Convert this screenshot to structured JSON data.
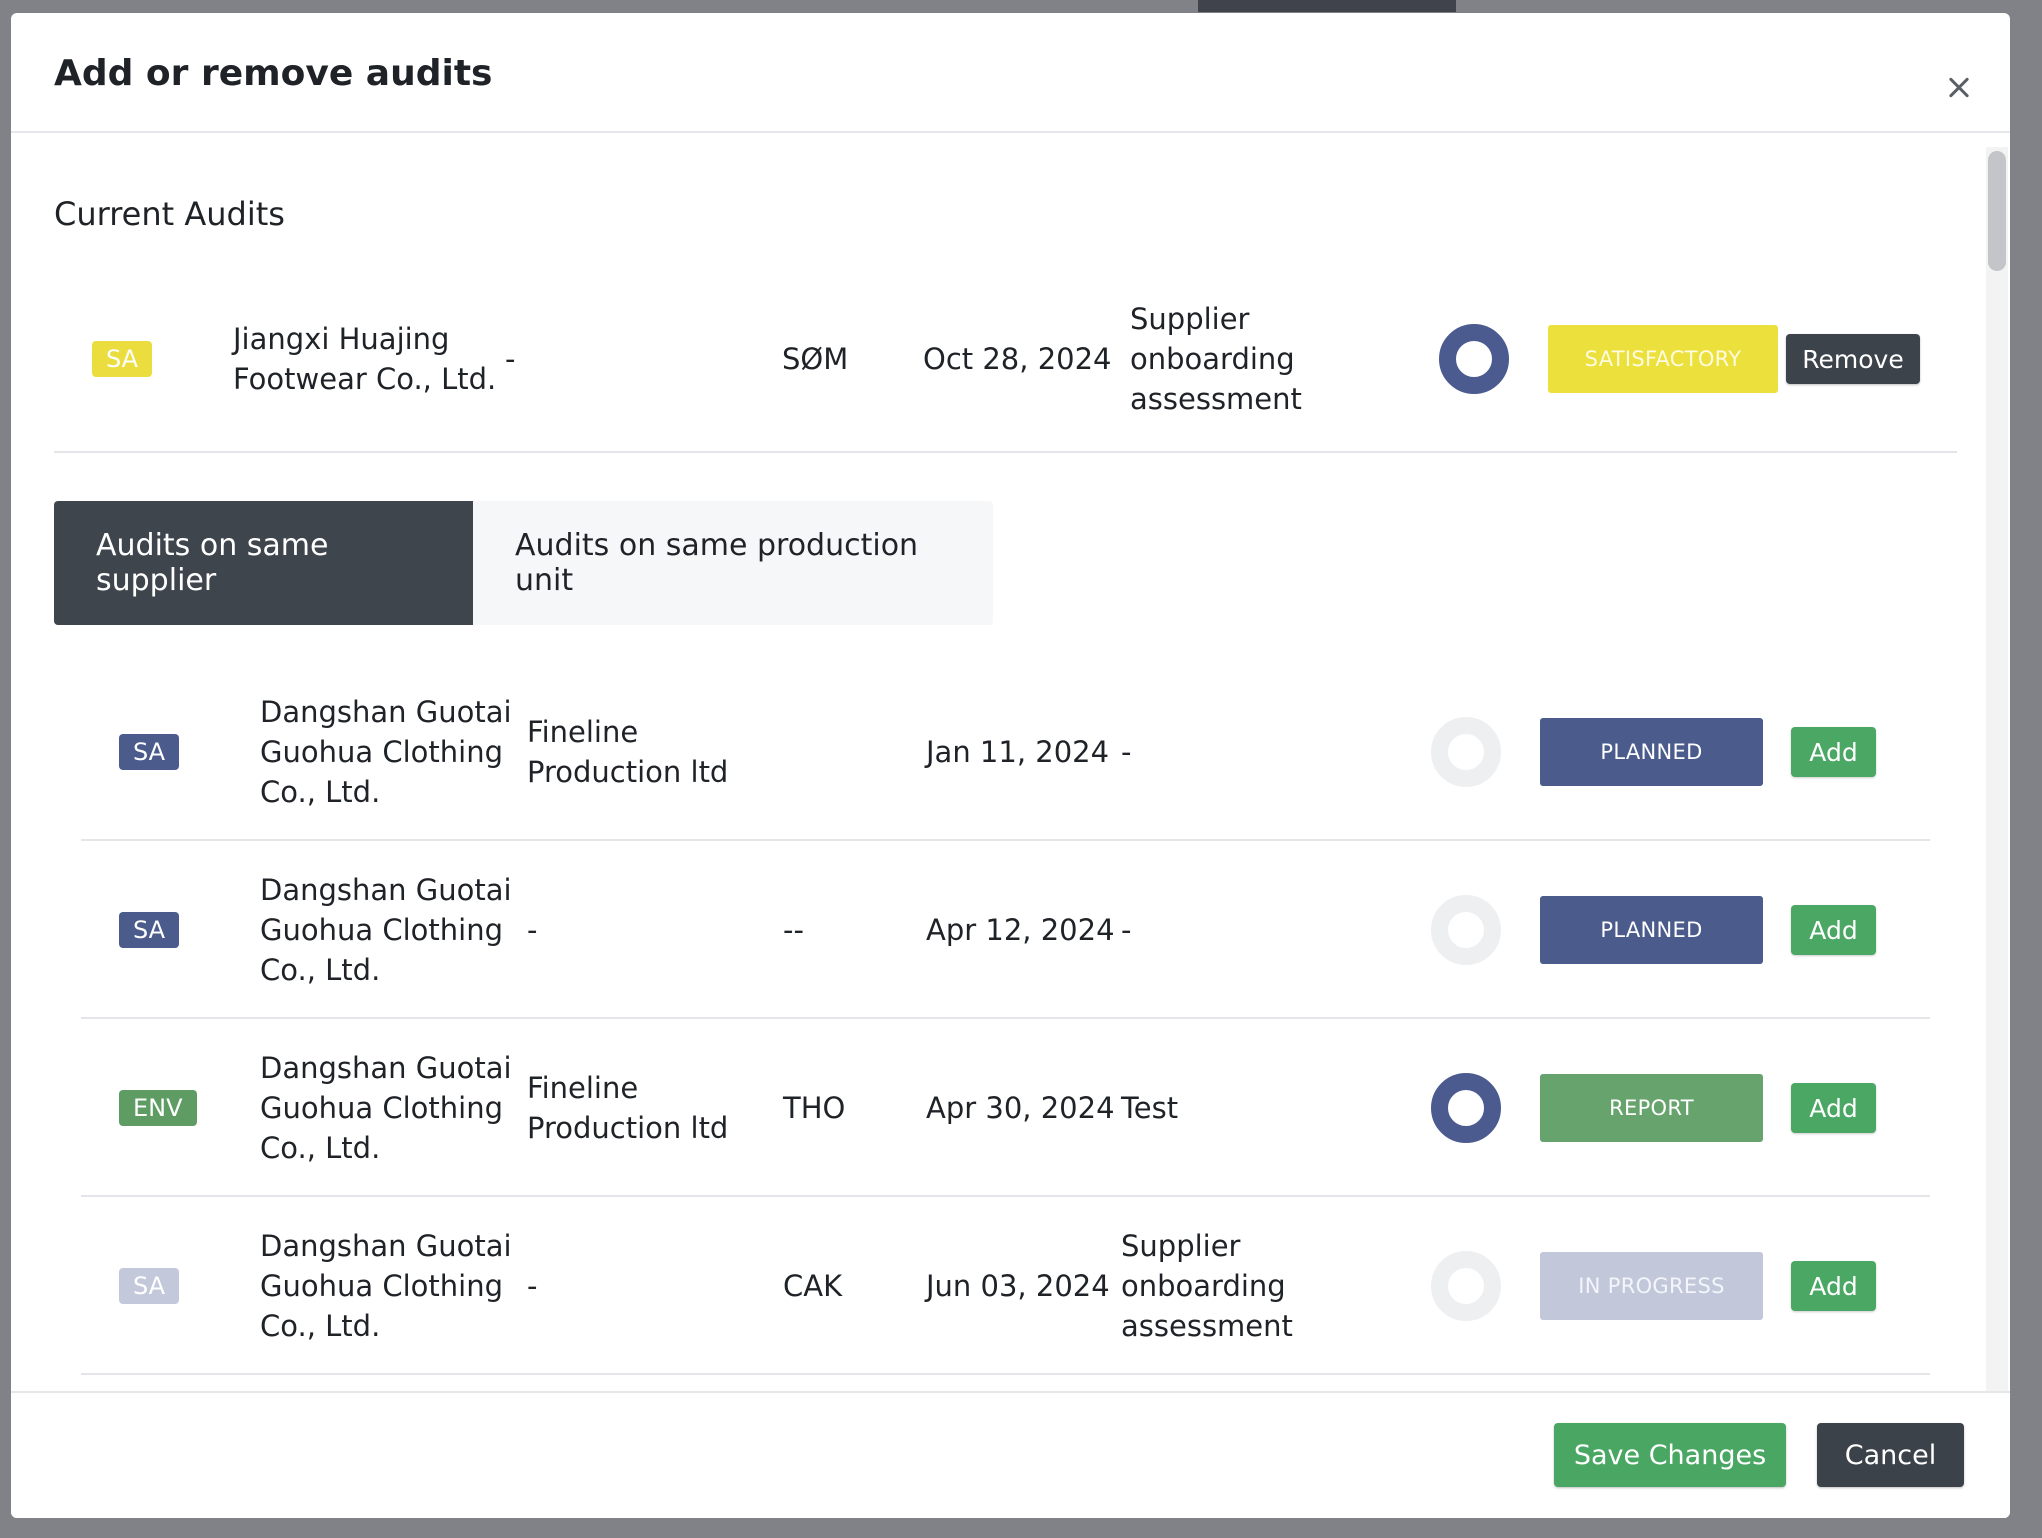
{
  "modal": {
    "title": "Add or remove audits",
    "section_title": "Current Audits"
  },
  "current_audit": {
    "badge": "SA",
    "supplier": "Jiangxi Huajing Footwear Co., Ltd.",
    "production_unit": "-",
    "initials": "SØM",
    "date": "Oct 28, 2024",
    "type": "Supplier onboarding assessment",
    "status": "SATISFACTORY",
    "action_label": "Remove"
  },
  "tabs": [
    {
      "label": "Audits on same supplier",
      "active": true
    },
    {
      "label": "Audits on same production unit",
      "active": false
    }
  ],
  "audits": [
    {
      "badge": "SA",
      "supplier": "Dangshan Guotai Guohua Clothing Co., Ltd.",
      "production_unit": "Fineline Production ltd",
      "initials": "",
      "date": "Jan 11, 2024",
      "type": "-",
      "status": "PLANNED",
      "action_label": "Add"
    },
    {
      "badge": "SA",
      "supplier": "Dangshan Guotai Guohua Clothing Co., Ltd.",
      "production_unit": "-",
      "initials": "--",
      "date": "Apr 12, 2024",
      "type": "-",
      "status": "PLANNED",
      "action_label": "Add"
    },
    {
      "badge": "ENV",
      "supplier": "Dangshan Guotai Guohua Clothing Co., Ltd.",
      "production_unit": "Fineline Production ltd",
      "initials": "THO",
      "date": "Apr 30, 2024",
      "type": "Test",
      "status": "REPORT",
      "action_label": "Add"
    },
    {
      "badge": "SA",
      "supplier": "Dangshan Guotai Guohua Clothing Co., Ltd.",
      "production_unit": "-",
      "initials": "CAK",
      "date": "Jun 03, 2024",
      "type": "Supplier onboarding assessment",
      "status": "IN PROGRESS",
      "action_label": "Add"
    }
  ],
  "footer": {
    "save_label": "Save Changes",
    "cancel_label": "Cancel"
  },
  "colors": {
    "badge_sa_yellow": "#ecdd3e",
    "badge_sa_blue": "#4a5b8c",
    "badge_env": "#5e9c63",
    "status_planned": "#4a5b8c",
    "status_report": "#67a36d",
    "status_satisfactory": "#ece03c",
    "status_in_progress": "#c2c8da",
    "add_button": "#4aa764",
    "dark_button": "#3d434b"
  }
}
